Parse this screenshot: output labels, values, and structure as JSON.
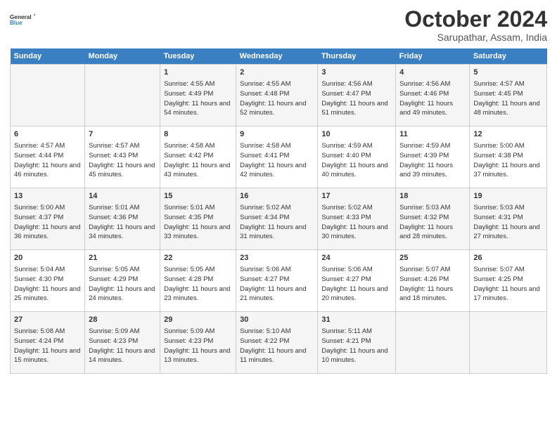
{
  "logo": {
    "general": "General",
    "blue": "Blue"
  },
  "title": "October 2024",
  "subtitle": "Sarupathar, Assam, India",
  "weekdays": [
    "Sunday",
    "Monday",
    "Tuesday",
    "Wednesday",
    "Thursday",
    "Friday",
    "Saturday"
  ],
  "weeks": [
    [
      {
        "day": "",
        "sunrise": "",
        "sunset": "",
        "daylight": ""
      },
      {
        "day": "",
        "sunrise": "",
        "sunset": "",
        "daylight": ""
      },
      {
        "day": "1",
        "sunrise": "Sunrise: 4:55 AM",
        "sunset": "Sunset: 4:49 PM",
        "daylight": "Daylight: 11 hours and 54 minutes."
      },
      {
        "day": "2",
        "sunrise": "Sunrise: 4:55 AM",
        "sunset": "Sunset: 4:48 PM",
        "daylight": "Daylight: 11 hours and 52 minutes."
      },
      {
        "day": "3",
        "sunrise": "Sunrise: 4:56 AM",
        "sunset": "Sunset: 4:47 PM",
        "daylight": "Daylight: 11 hours and 51 minutes."
      },
      {
        "day": "4",
        "sunrise": "Sunrise: 4:56 AM",
        "sunset": "Sunset: 4:46 PM",
        "daylight": "Daylight: 11 hours and 49 minutes."
      },
      {
        "day": "5",
        "sunrise": "Sunrise: 4:57 AM",
        "sunset": "Sunset: 4:45 PM",
        "daylight": "Daylight: 11 hours and 48 minutes."
      }
    ],
    [
      {
        "day": "6",
        "sunrise": "Sunrise: 4:57 AM",
        "sunset": "Sunset: 4:44 PM",
        "daylight": "Daylight: 11 hours and 46 minutes."
      },
      {
        "day": "7",
        "sunrise": "Sunrise: 4:57 AM",
        "sunset": "Sunset: 4:43 PM",
        "daylight": "Daylight: 11 hours and 45 minutes."
      },
      {
        "day": "8",
        "sunrise": "Sunrise: 4:58 AM",
        "sunset": "Sunset: 4:42 PM",
        "daylight": "Daylight: 11 hours and 43 minutes."
      },
      {
        "day": "9",
        "sunrise": "Sunrise: 4:58 AM",
        "sunset": "Sunset: 4:41 PM",
        "daylight": "Daylight: 11 hours and 42 minutes."
      },
      {
        "day": "10",
        "sunrise": "Sunrise: 4:59 AM",
        "sunset": "Sunset: 4:40 PM",
        "daylight": "Daylight: 11 hours and 40 minutes."
      },
      {
        "day": "11",
        "sunrise": "Sunrise: 4:59 AM",
        "sunset": "Sunset: 4:39 PM",
        "daylight": "Daylight: 11 hours and 39 minutes."
      },
      {
        "day": "12",
        "sunrise": "Sunrise: 5:00 AM",
        "sunset": "Sunset: 4:38 PM",
        "daylight": "Daylight: 11 hours and 37 minutes."
      }
    ],
    [
      {
        "day": "13",
        "sunrise": "Sunrise: 5:00 AM",
        "sunset": "Sunset: 4:37 PM",
        "daylight": "Daylight: 11 hours and 36 minutes."
      },
      {
        "day": "14",
        "sunrise": "Sunrise: 5:01 AM",
        "sunset": "Sunset: 4:36 PM",
        "daylight": "Daylight: 11 hours and 34 minutes."
      },
      {
        "day": "15",
        "sunrise": "Sunrise: 5:01 AM",
        "sunset": "Sunset: 4:35 PM",
        "daylight": "Daylight: 11 hours and 33 minutes."
      },
      {
        "day": "16",
        "sunrise": "Sunrise: 5:02 AM",
        "sunset": "Sunset: 4:34 PM",
        "daylight": "Daylight: 11 hours and 31 minutes."
      },
      {
        "day": "17",
        "sunrise": "Sunrise: 5:02 AM",
        "sunset": "Sunset: 4:33 PM",
        "daylight": "Daylight: 11 hours and 30 minutes."
      },
      {
        "day": "18",
        "sunrise": "Sunrise: 5:03 AM",
        "sunset": "Sunset: 4:32 PM",
        "daylight": "Daylight: 11 hours and 28 minutes."
      },
      {
        "day": "19",
        "sunrise": "Sunrise: 5:03 AM",
        "sunset": "Sunset: 4:31 PM",
        "daylight": "Daylight: 11 hours and 27 minutes."
      }
    ],
    [
      {
        "day": "20",
        "sunrise": "Sunrise: 5:04 AM",
        "sunset": "Sunset: 4:30 PM",
        "daylight": "Daylight: 11 hours and 25 minutes."
      },
      {
        "day": "21",
        "sunrise": "Sunrise: 5:05 AM",
        "sunset": "Sunset: 4:29 PM",
        "daylight": "Daylight: 11 hours and 24 minutes."
      },
      {
        "day": "22",
        "sunrise": "Sunrise: 5:05 AM",
        "sunset": "Sunset: 4:28 PM",
        "daylight": "Daylight: 11 hours and 23 minutes."
      },
      {
        "day": "23",
        "sunrise": "Sunrise: 5:06 AM",
        "sunset": "Sunset: 4:27 PM",
        "daylight": "Daylight: 11 hours and 21 minutes."
      },
      {
        "day": "24",
        "sunrise": "Sunrise: 5:06 AM",
        "sunset": "Sunset: 4:27 PM",
        "daylight": "Daylight: 11 hours and 20 minutes."
      },
      {
        "day": "25",
        "sunrise": "Sunrise: 5:07 AM",
        "sunset": "Sunset: 4:26 PM",
        "daylight": "Daylight: 11 hours and 18 minutes."
      },
      {
        "day": "26",
        "sunrise": "Sunrise: 5:07 AM",
        "sunset": "Sunset: 4:25 PM",
        "daylight": "Daylight: 11 hours and 17 minutes."
      }
    ],
    [
      {
        "day": "27",
        "sunrise": "Sunrise: 5:08 AM",
        "sunset": "Sunset: 4:24 PM",
        "daylight": "Daylight: 11 hours and 15 minutes."
      },
      {
        "day": "28",
        "sunrise": "Sunrise: 5:09 AM",
        "sunset": "Sunset: 4:23 PM",
        "daylight": "Daylight: 11 hours and 14 minutes."
      },
      {
        "day": "29",
        "sunrise": "Sunrise: 5:09 AM",
        "sunset": "Sunset: 4:23 PM",
        "daylight": "Daylight: 11 hours and 13 minutes."
      },
      {
        "day": "30",
        "sunrise": "Sunrise: 5:10 AM",
        "sunset": "Sunset: 4:22 PM",
        "daylight": "Daylight: 11 hours and 11 minutes."
      },
      {
        "day": "31",
        "sunrise": "Sunrise: 5:11 AM",
        "sunset": "Sunset: 4:21 PM",
        "daylight": "Daylight: 11 hours and 10 minutes."
      },
      {
        "day": "",
        "sunrise": "",
        "sunset": "",
        "daylight": ""
      },
      {
        "day": "",
        "sunrise": "",
        "sunset": "",
        "daylight": ""
      }
    ]
  ]
}
